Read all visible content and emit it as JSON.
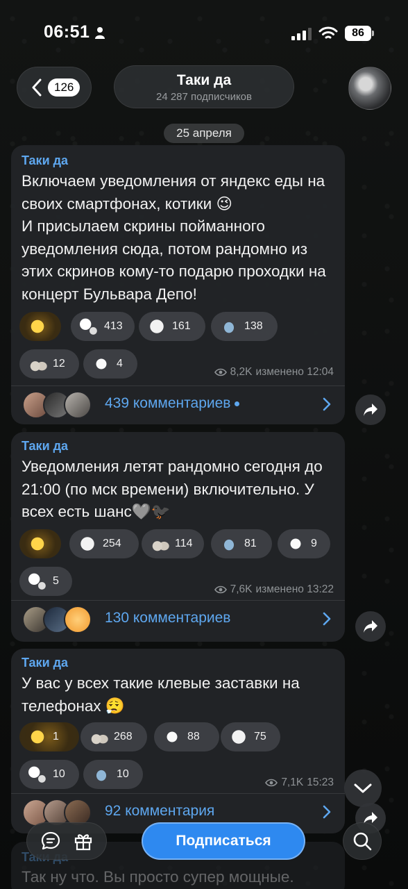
{
  "status_bar": {
    "time": "06:51",
    "battery": "86"
  },
  "header": {
    "back_count": "126",
    "title": "Таки да",
    "subtitle": "24 287 подписчиков"
  },
  "date_chip": "25 апреля",
  "messages": [
    {
      "author": "Таки да",
      "text": "Включаем уведомления от яндекс еды на своих смартфонах, котики 😉\nИ присылаем скрины пойманного уведомления сюда, потом рандомно из этих скринов кому-то подарю проходки на концерт Бульвара Депо!",
      "reactions": [
        {
          "emoji": "star",
          "count": ""
        },
        {
          "emoji": "snow",
          "count": "413"
        },
        {
          "emoji": "heart",
          "count": "161"
        },
        {
          "emoji": "dolphin",
          "count": "138"
        },
        {
          "emoji": "bunny",
          "count": "12"
        },
        {
          "emoji": "hands",
          "count": "4"
        }
      ],
      "views": "8,2K",
      "edited": "изменено 12:04",
      "comments": "439 комментариев"
    },
    {
      "author": "Таки да",
      "text": "Уведомления летят рандомно сегодня до 21:00 (по мск времени) включительно. У всех есть шанс🩶🐦‍⬛",
      "reactions": [
        {
          "emoji": "star",
          "count": ""
        },
        {
          "emoji": "heart",
          "count": "254"
        },
        {
          "emoji": "bunny",
          "count": "114"
        },
        {
          "emoji": "dolphin",
          "count": "81"
        },
        {
          "emoji": "hands",
          "count": "9"
        },
        {
          "emoji": "snow",
          "count": "5"
        }
      ],
      "views": "7,6K",
      "edited": "изменено 13:22",
      "comments": "130 комментариев"
    },
    {
      "author": "Таки да",
      "text": "У вас у всех такие клевые заставки на телефонах 😮‍💨",
      "reactions": [
        {
          "emoji": "star",
          "count": "1"
        },
        {
          "emoji": "bunny",
          "count": "268"
        },
        {
          "emoji": "hands",
          "count": "88"
        },
        {
          "emoji": "heart",
          "count": "75"
        },
        {
          "emoji": "snow",
          "count": "10"
        },
        {
          "emoji": "dolphin",
          "count": "10"
        }
      ],
      "views": "7,1K",
      "edited": "15:23",
      "comments": "92 комментария"
    }
  ],
  "peek": {
    "author": "Таки да",
    "text": "Так ну что. Вы просто супер мощные."
  },
  "bottom": {
    "subscribe_label": "Подписаться"
  },
  "colors": {
    "accent": "#5ea7ef",
    "subscribe": "#2e89f0"
  }
}
